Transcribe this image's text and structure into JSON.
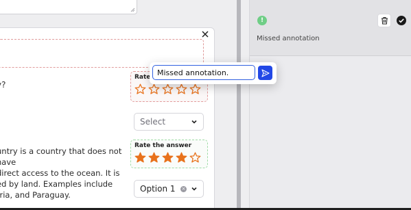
{
  "question": {
    "fragment": "y?"
  },
  "rating_top": {
    "label": "Rate",
    "stars": 0,
    "max": 5
  },
  "select_1": {
    "value": "Select"
  },
  "answer": {
    "lines": [
      "untry is a country that does not have",
      "direct access to the ocean. It is",
      "ed by land. Examples include",
      "tria, and Paraguay."
    ]
  },
  "rating_bottom": {
    "label": "Rate the answer",
    "stars": 4,
    "max": 5
  },
  "select_2": {
    "value": "Option 1"
  },
  "annotation": {
    "text": "Missed annotation",
    "badge": "!"
  },
  "popup": {
    "value": "Missed annotation."
  },
  "colors": {
    "star": "#e8721c",
    "send": "#2248e6",
    "badge": "#6fce86"
  },
  "icons": {
    "close": "close-icon",
    "trash": "trash-icon",
    "check": "check-circle-icon",
    "send": "send-icon",
    "chevron": "chevron-down-icon"
  }
}
